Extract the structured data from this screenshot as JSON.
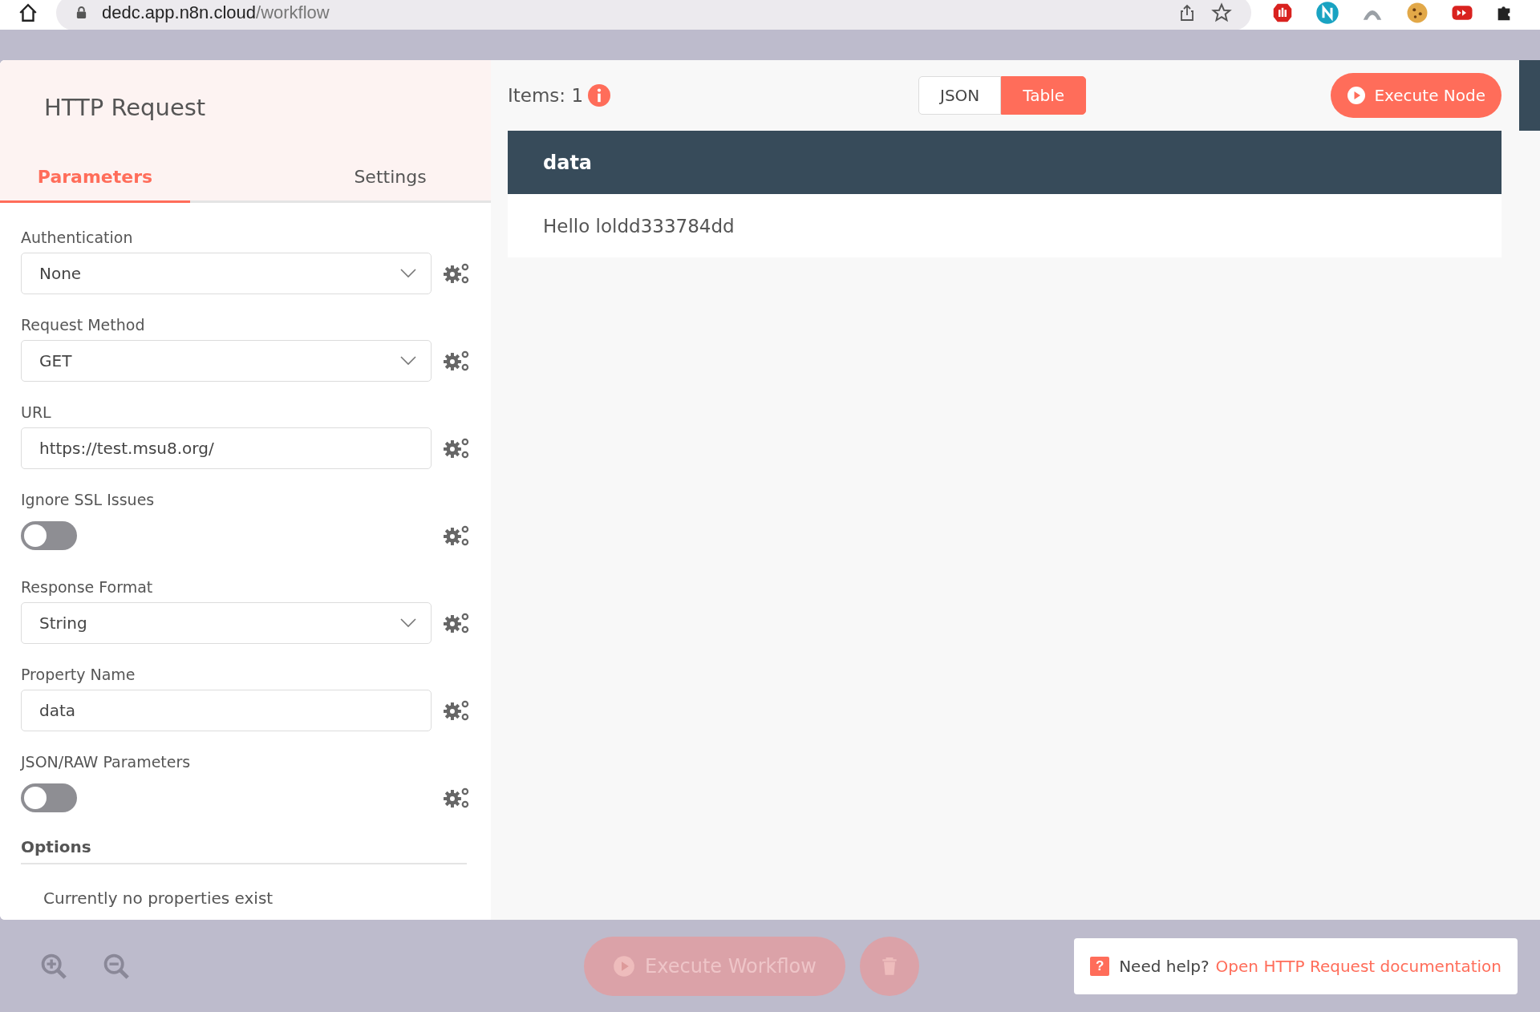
{
  "browser": {
    "url_host": "dedc.app.n8n.cloud",
    "url_path": "/workflow"
  },
  "node_panel": {
    "title": "HTTP Request",
    "tabs": [
      {
        "label": "Parameters",
        "selected": true
      },
      {
        "label": "Settings",
        "selected": false
      }
    ],
    "parameters": [
      {
        "kind": "select",
        "label": "Authentication",
        "value": "None"
      },
      {
        "kind": "select",
        "label": "Request Method",
        "value": "GET"
      },
      {
        "kind": "input",
        "label": "URL",
        "value": "https://test.msu8.org/"
      },
      {
        "kind": "toggle",
        "label": "Ignore SSL Issues",
        "on": false
      },
      {
        "kind": "select",
        "label": "Response Format",
        "value": "String"
      },
      {
        "kind": "input",
        "label": "Property Name",
        "value": "data"
      },
      {
        "kind": "toggle",
        "label": "JSON/RAW Parameters",
        "on": false
      }
    ],
    "options": {
      "heading": "Options",
      "empty_text": "Currently no properties exist"
    }
  },
  "output": {
    "items_label": "Items: 1",
    "view_modes": [
      {
        "label": "JSON",
        "selected": false
      },
      {
        "label": "Table",
        "selected": true
      }
    ],
    "execute_button": "Execute Node",
    "table": {
      "columns": [
        "data"
      ],
      "rows": [
        [
          "Hello loldd333784dd"
        ]
      ]
    }
  },
  "footer": {
    "help_icon": "?",
    "execute_workflow": "Execute Workflow",
    "help_prefix": "Need help?",
    "help_link": "Open HTTP Request documentation"
  }
}
